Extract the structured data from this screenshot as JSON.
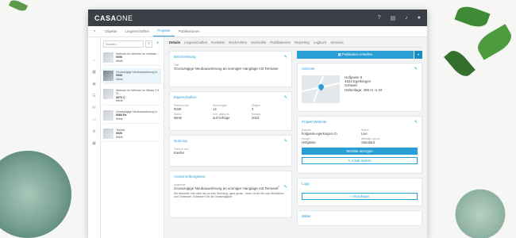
{
  "app": {
    "logo_main": "CASA",
    "logo_sub": "ONE"
  },
  "topbar_icons": [
    "help-icon",
    "document-icon",
    "bell-icon",
    "user-icon"
  ],
  "tabs": [
    "Objekte",
    "Liegenschaften",
    "Projekte",
    "Publikationen"
  ],
  "active_tab": 2,
  "search": {
    "placeholder": "Suchen"
  },
  "list_items": [
    {
      "title": "Wohnen im Wohnen im zentrale...",
      "code": "0006",
      "status": "Miete"
    },
    {
      "title": "Grosszügige Neubauwohnung in ...",
      "code": "0030",
      "status": "Miete"
    },
    {
      "title": "Wohnen im Wohnen im Altbau 3.5 Zi...",
      "code": "0072 C",
      "status": "Miete"
    },
    {
      "title": "Grosszügige Neubauwohnung in ...",
      "code": "0084 Fa",
      "status": "Miete"
    },
    {
      "title": "Testobj",
      "code": "0026",
      "status": "Miete"
    }
  ],
  "detail_tabs": [
    "Details",
    "Liegenschaften",
    "Kontakte",
    "Nachrichten",
    "Suchrofile",
    "Publikationen",
    "Reporting",
    "Logbuch",
    "Services"
  ],
  "beschreibung": {
    "title": "Beschreibung",
    "label": "Titel",
    "text": "Grosszügige Neubauwohnung an sonniger Hanglage mit Terrasse"
  },
  "eigenschaften": {
    "title": "Eigenschaften",
    "fields": [
      {
        "label": "Referenz-Nr.",
        "value": "0040"
      },
      {
        "label": "Wohnungen",
        "value": "14"
      },
      {
        "label": "Etagen",
        "value": "3"
      },
      {
        "label": "Status",
        "value": "Miete"
      },
      {
        "label": "Verf. gültig ab",
        "value": "auf Anfrage"
      },
      {
        "label": "Baujahr",
        "value": "2019"
      }
    ]
  },
  "nutzung": {
    "title": "Nutzung",
    "label": "Genutzt aus",
    "value": "Kaufen"
  },
  "ausschreibung": {
    "title": "Ausschreibungstext",
    "label": "Angebote",
    "text": "Grosszügige Neubauwohnung an sonniger Hanglage mit Terrasse",
    "body": "Wir verkaufen hier mehr als nur eine Wohnung, ganz genau - einen Ort für Sie zum Wohlfühlen und Geniessen. Entdecken Sie die Grosszügigkeit"
  },
  "publish": {
    "label": "Publikation erstellen"
  },
  "adresse": {
    "title": "Adresse",
    "lines": [
      "Hofgasse 5",
      "4622 Egerkingen",
      "Schweiz",
      "Höhenlage: 490 m. ü. M."
    ]
  },
  "projekt_website": {
    "title": "Projekt Website",
    "fields": [
      {
        "label": "Domain",
        "value": "hofgasse-egerkingen.ch"
      },
      {
        "label": "Status",
        "value": "Live"
      },
      {
        "label": "Design",
        "value": "Hofgasse"
      },
      {
        "label": "Website-Layout",
        "value": "Standard"
      }
    ],
    "show_button": "Website anzeigen",
    "edit_button": "Inhalt ändern"
  },
  "logo_card": {
    "title": "Logo",
    "button": "+ Hinzufügen"
  },
  "bilder_card": {
    "title": "Bilder"
  },
  "colors": {
    "accent": "#2a9fd6",
    "topbar": "#3a3f45"
  }
}
